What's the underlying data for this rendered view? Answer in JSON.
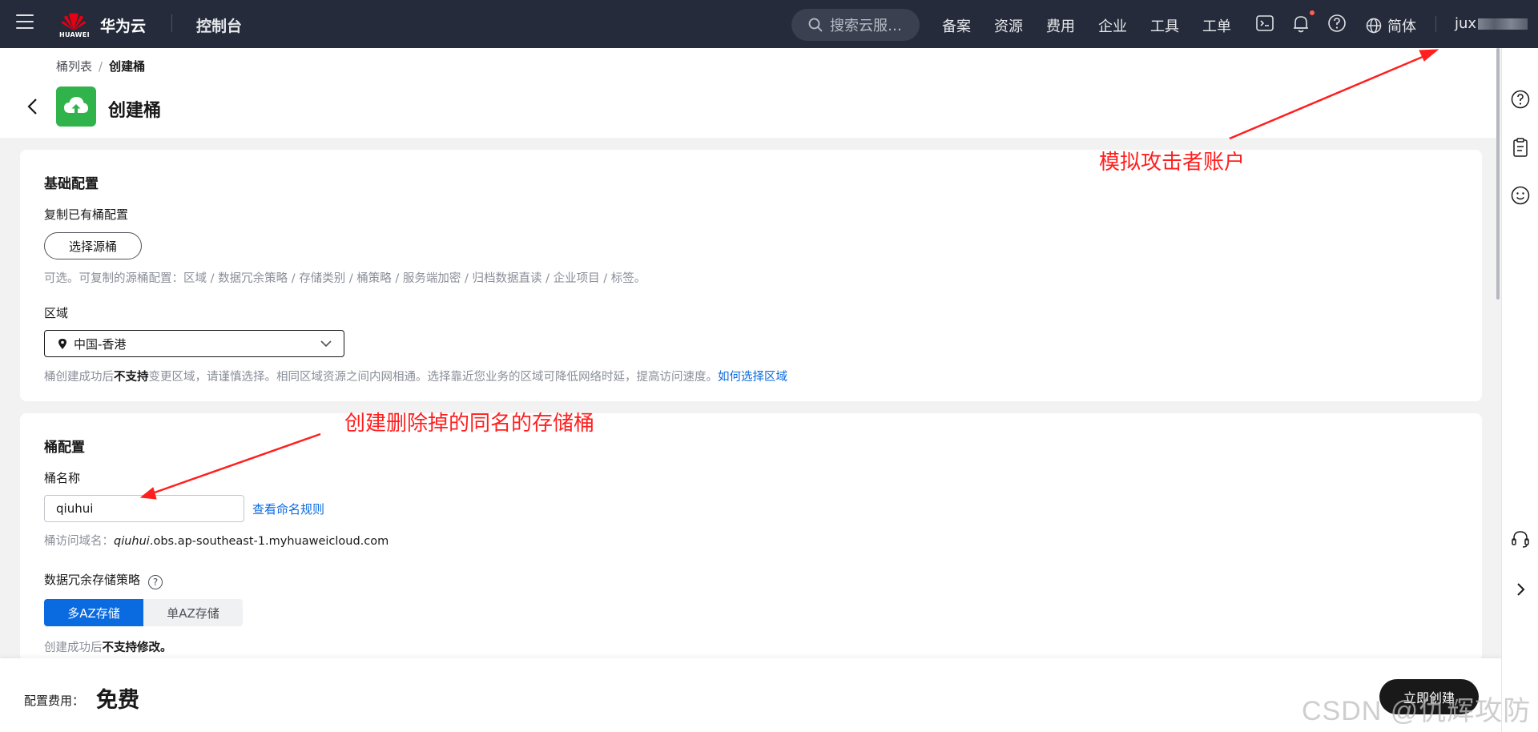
{
  "topnav": {
    "logo_text": "HUAWEI",
    "brand": "华为云",
    "console": "控制台",
    "search_placeholder": "搜索云服…",
    "links": [
      "备案",
      "资源",
      "费用",
      "企业",
      "工具",
      "工单"
    ],
    "language": "简体",
    "user": "jux"
  },
  "breadcrumb": {
    "parent": "桶列表",
    "separator": "/",
    "current": "创建桶"
  },
  "page": {
    "title": "创建桶"
  },
  "basic_config": {
    "title": "基础配置",
    "copy_label": "复制已有桶配置",
    "select_source_button": "选择源桶",
    "copy_hint": "可选。可复制的源桶配置：区域 / 数据冗余策略 / 存储类别 / 桶策略 / 服务端加密 / 归档数据直读 / 企业项目 / 标签。",
    "region_label": "区域",
    "region_value": "中国-香港",
    "region_hint_pre": "桶创建成功后",
    "region_hint_bold": "不支持",
    "region_hint_post": "变更区域，请谨慎选择。相同区域资源之间内网相通。选择靠近您业务的区域可降低网络时延，提高访问速度。",
    "region_help_link": "如何选择区域"
  },
  "bucket_config": {
    "title": "桶配置",
    "name_label": "桶名称",
    "name_value": "qiuhui",
    "naming_rules_link": "查看命名规则",
    "domain_prefix": "桶访问域名：",
    "domain_name": "qiuhui",
    "domain_suffix": ".obs.ap-southeast-1.myhuaweicloud.com",
    "redundancy_label": "数据冗余存储策略",
    "redundancy_options": [
      "多AZ存储",
      "单AZ存储"
    ],
    "redundancy_selected": "多AZ存储",
    "redundancy_hint_pre": "创建成功后",
    "redundancy_hint_bold": "不支持修改。"
  },
  "footer": {
    "fee_label": "配置费用：",
    "fee_value": "免费",
    "create_button": "立即创建"
  },
  "annotations": {
    "attacker_account": "模拟攻击者账户",
    "recreate_bucket": "创建删除掉的同名的存储桶"
  },
  "watermark": "CSDN @仇辉攻防",
  "colors": {
    "topbar": "#252b3a",
    "accent": "#0a6ae0",
    "bucket_icon": "#31b34c",
    "annotation": "#ff1f1f"
  },
  "icons": [
    "menu-icon",
    "huawei-logo",
    "search-icon",
    "terminal-icon",
    "bell-icon",
    "help-icon",
    "globe-icon",
    "back-icon",
    "cloud-upload-icon",
    "location-icon",
    "chevron-down-icon",
    "clipboard-icon",
    "smiley-icon",
    "headset-icon",
    "chevron-right-icon"
  ]
}
